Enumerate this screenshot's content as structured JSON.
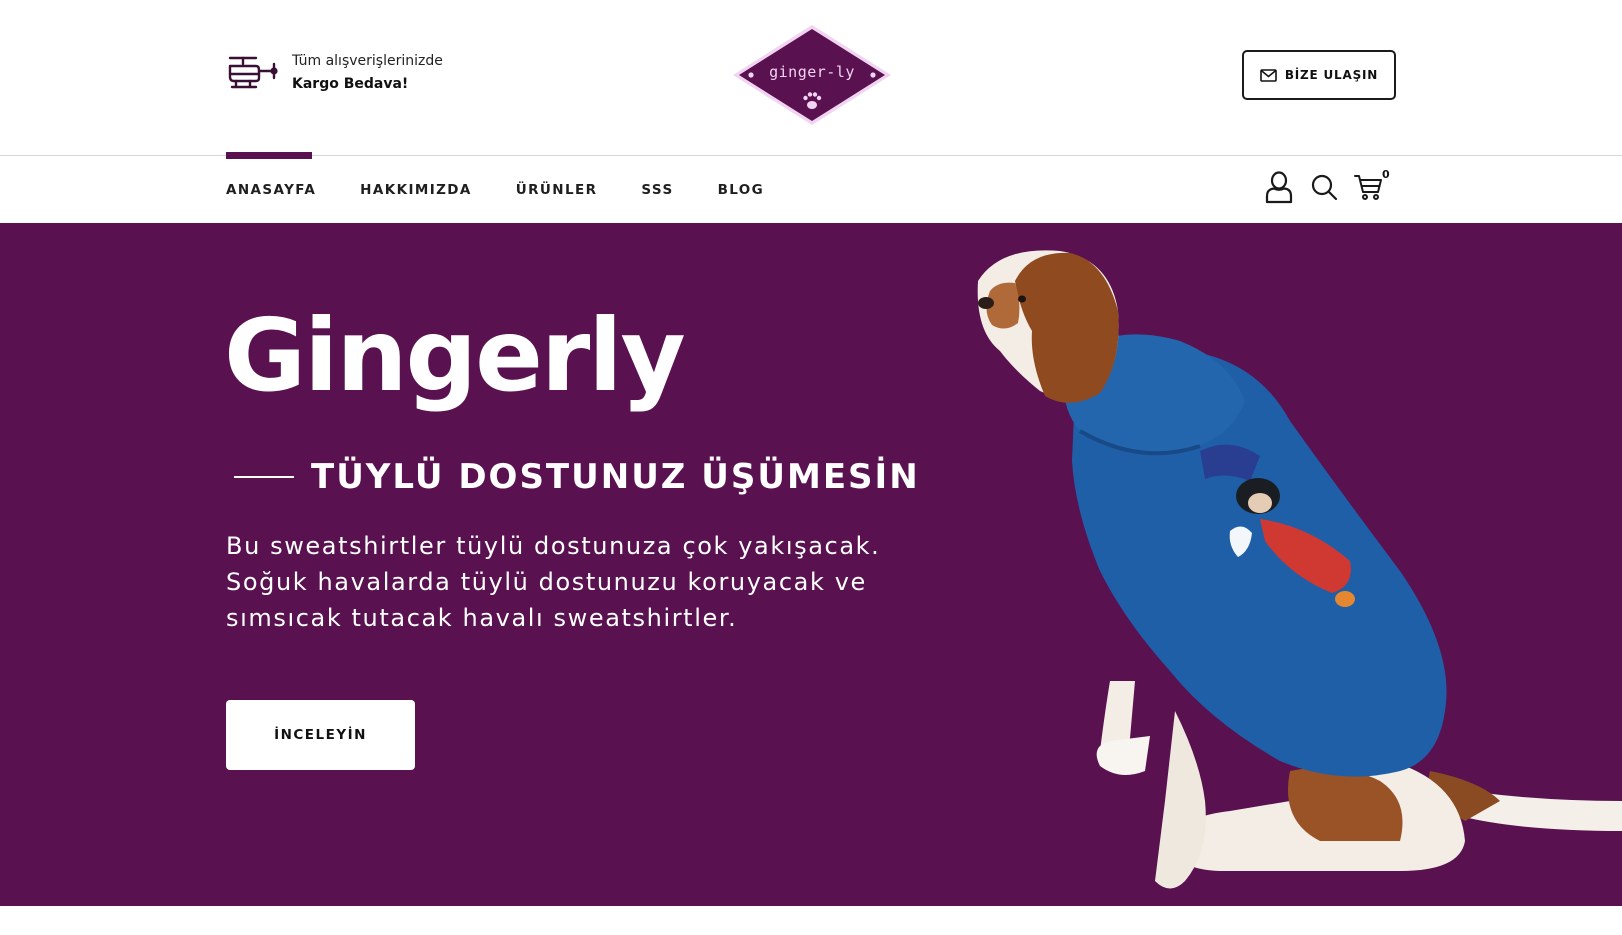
{
  "topbar": {
    "shipping_line1": "Tüm alışverişlerinizde",
    "shipping_line2": "Kargo Bedava!",
    "logo_text": "ginger-ly",
    "contact_label": "BİZE ULAŞIN"
  },
  "nav": {
    "items": [
      "ANASAYFA",
      "HAKKIMIZDA",
      "ÜRÜNLER",
      "SSS",
      "BLOG"
    ],
    "active_index": 0,
    "cart_count": "0"
  },
  "hero": {
    "title": "Gingerly",
    "subtitle": "TÜYLÜ DOSTUNUZ ÜŞÜMESİN",
    "description": "Bu sweatshirtler tüylü dostunuza çok yakışacak. Soğuk havalarda tüylü dostunuzu koruyacak ve sımsıcak tutacak havalı sweatshirtler.",
    "cta_label": "İNCELEYİN"
  },
  "icons": {
    "shipping": "helicopter-icon",
    "contact": "mail-icon",
    "account": "user-icon",
    "search": "search-icon",
    "cart": "cart-icon",
    "paw": "paw-icon"
  },
  "colors": {
    "brand_purple": "#5a1150",
    "logo_pink": "#f1d4f1",
    "text_dark": "#1c1c1c",
    "hoodie_blue": "#1f5fa8"
  }
}
